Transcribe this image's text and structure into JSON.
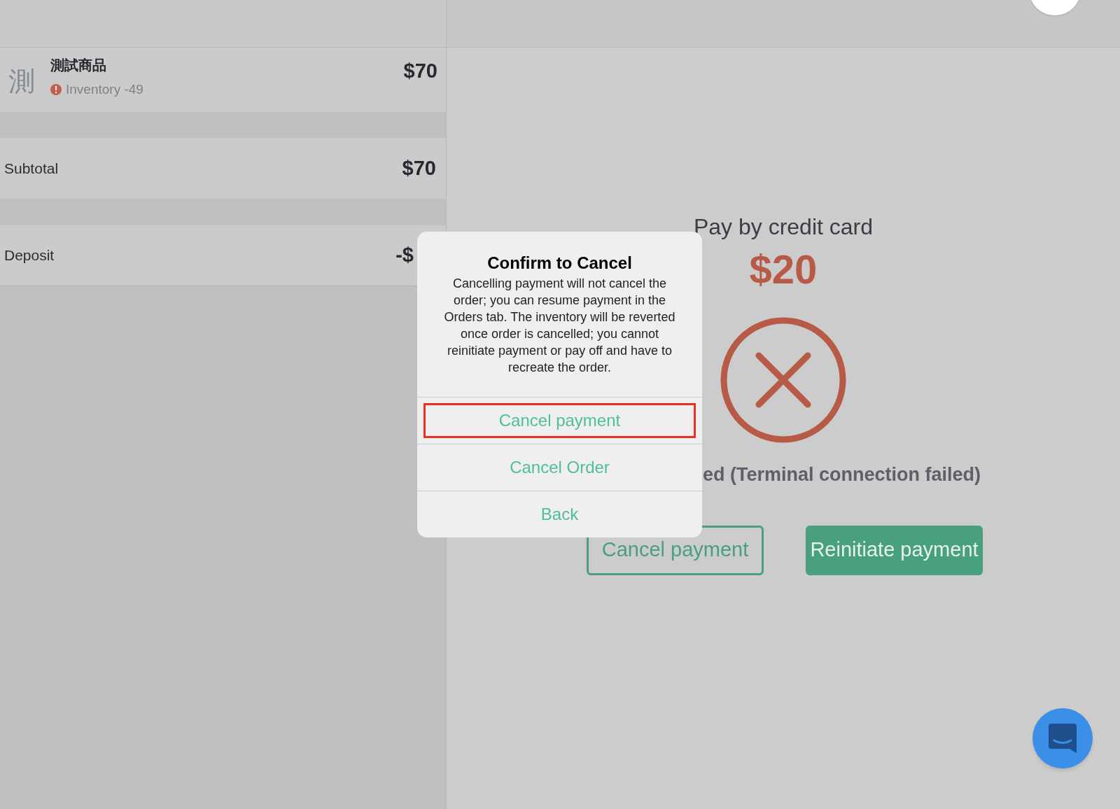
{
  "cart": {
    "items": [
      {
        "avatar": "測",
        "name": "測試商品",
        "warning": "Inventory -49",
        "price": "$70"
      }
    ],
    "summary": [
      {
        "label": "Subtotal",
        "amount": "$70"
      },
      {
        "label": "Deposit",
        "amount": "-$"
      }
    ]
  },
  "payment": {
    "title": "Pay by credit card",
    "amount": "$20",
    "status": "ed (Terminal connection failed)",
    "buttons": [
      {
        "label": "Cancel payment",
        "kind": "outline"
      },
      {
        "label": "Reinitiate payment",
        "kind": "filled"
      }
    ]
  },
  "dialog": {
    "title": "Confirm to Cancel",
    "message": "Cancelling payment will not cancel the order; you can resume payment in the Orders tab. The inventory will be reverted once order is cancelled; you cannot reinitiate payment or pay off and have to recreate the order.",
    "actions": [
      {
        "label": "Cancel payment",
        "highlighted": true
      },
      {
        "label": "Cancel Order",
        "highlighted": false
      },
      {
        "label": "Back",
        "highlighted": false
      }
    ]
  }
}
